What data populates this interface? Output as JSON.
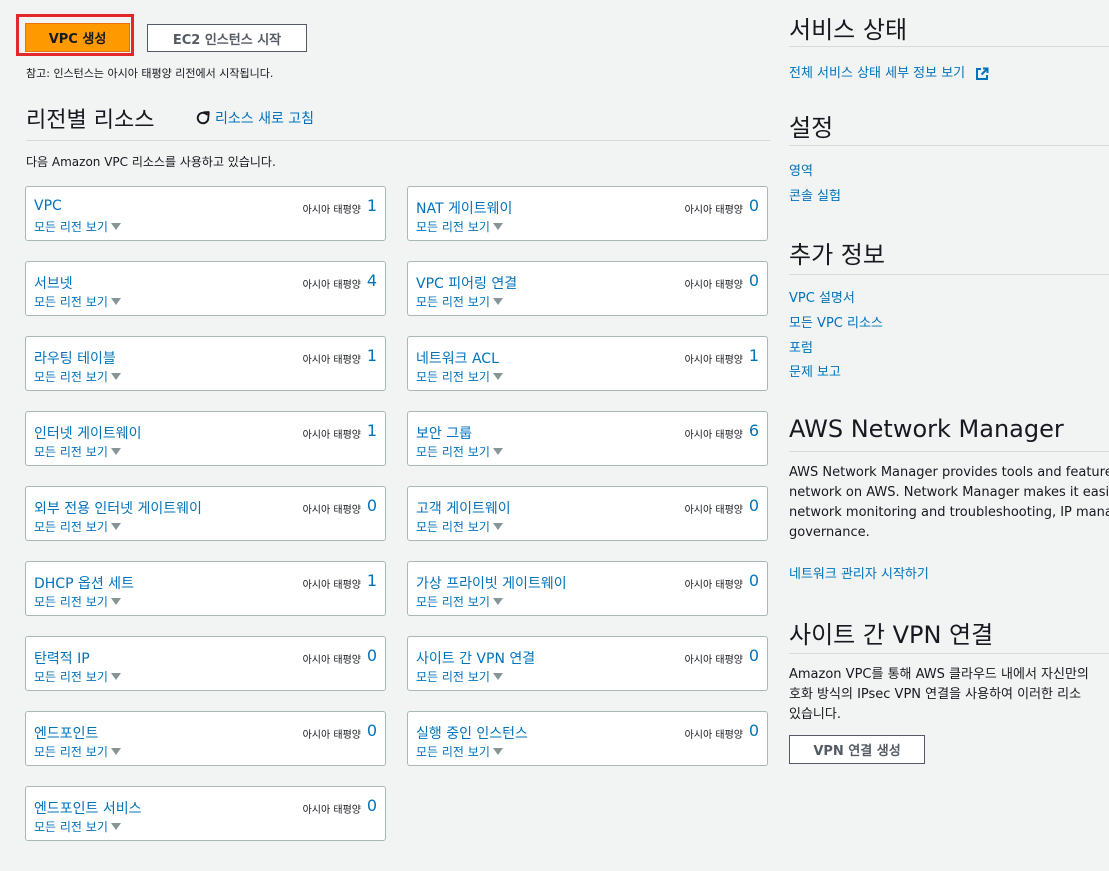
{
  "buttons": {
    "create_vpc": "VPC 생성",
    "launch_ec2": "EC2 인스턴스 시작"
  },
  "note": "참고: 인스턴스는 아시아 태평양 리전에서 시작됩니다.",
  "resources": {
    "title": "리전별 리소스",
    "refresh": "리소스 새로 고침",
    "intro": "다음 Amazon VPC 리소스를 사용하고 있습니다.",
    "view_all": "모든 리전 보기",
    "region": "아시아 태평양",
    "left_cards": [
      {
        "name": "VPC",
        "count": "1"
      },
      {
        "name": "서브넷",
        "count": "4"
      },
      {
        "name": "라우팅 테이블",
        "count": "1"
      },
      {
        "name": "인터넷 게이트웨이",
        "count": "1"
      },
      {
        "name": "외부 전용 인터넷 게이트웨이",
        "count": "0"
      },
      {
        "name": "DHCP 옵션 세트",
        "count": "1"
      },
      {
        "name": "탄력적 IP",
        "count": "0"
      },
      {
        "name": "엔드포인트",
        "count": "0"
      },
      {
        "name": "엔드포인트 서비스",
        "count": "0"
      }
    ],
    "right_cards": [
      {
        "name": "NAT 게이트웨이",
        "count": "0"
      },
      {
        "name": "VPC 피어링 연결",
        "count": "0"
      },
      {
        "name": "네트워크 ACL",
        "count": "1"
      },
      {
        "name": "보안 그룹",
        "count": "6"
      },
      {
        "name": "고객 게이트웨이",
        "count": "0"
      },
      {
        "name": "가상 프라이빗 게이트웨이",
        "count": "0"
      },
      {
        "name": "사이트 간 VPN 연결",
        "count": "0"
      },
      {
        "name": "실행 중인 인스턴스",
        "count": "0"
      }
    ]
  },
  "side": {
    "service_status": {
      "title": "서비스 상태",
      "link": "전체 서비스 상태 세부 정보 보기"
    },
    "settings": {
      "title": "설정",
      "links": [
        "영역",
        "콘솔 실험"
      ]
    },
    "additional_info": {
      "title": "추가 정보",
      "links": [
        "VPC 설명서",
        "모든 VPC 리소스",
        "포럼",
        "문제 보고"
      ]
    },
    "network_manager": {
      "title": "AWS Network Manager",
      "lines": [
        "AWS Network Manager provides tools and features",
        "network on AWS. Network Manager makes it easier",
        "network monitoring and troubleshooting, IP mana",
        "governance."
      ],
      "link": "네트워크 관리자 시작하기"
    },
    "site_vpn": {
      "title": "사이트 간 VPN 연결",
      "lines": [
        "Amazon VPC를 통해 AWS 클라우드 내에서 자신만의",
        "호화 방식의 IPsec VPN 연결을 사용하여 이러한 리소",
        "있습니다."
      ],
      "button": "VPN 연결 생성"
    }
  }
}
